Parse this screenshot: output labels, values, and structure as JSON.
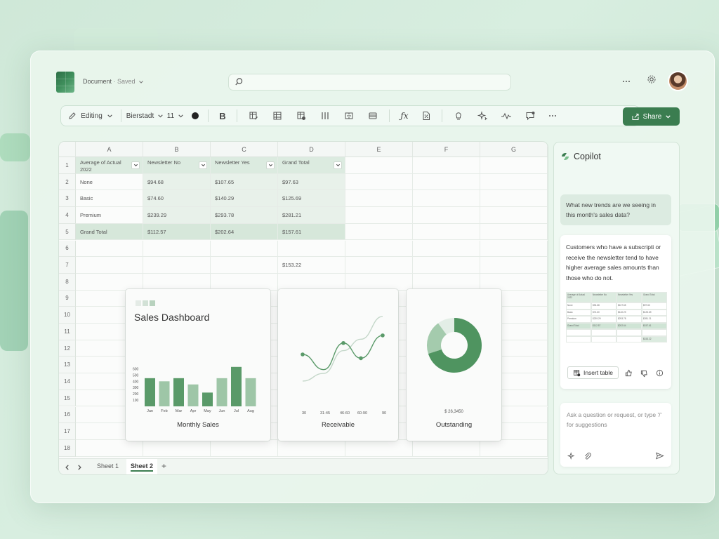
{
  "app": {
    "title": "Document",
    "status": "Saved",
    "search_placeholder": ""
  },
  "ribbon": {
    "mode": "Editing",
    "font": "Bierstadt",
    "font_size": "11",
    "bold": "B",
    "share": "Share"
  },
  "grid": {
    "columns": [
      "A",
      "B",
      "C",
      "D",
      "E",
      "F",
      "G"
    ],
    "rows": [
      "1",
      "2",
      "3",
      "4",
      "5",
      "6",
      "7",
      "8",
      "9",
      "10",
      "11",
      "12",
      "13",
      "14",
      "15",
      "16",
      "17",
      "18"
    ],
    "pivot_headers": [
      "Average of Actual 2022",
      "Newsletter No",
      "Newsletter Yes",
      "Grand Total"
    ],
    "pivot_rows": [
      [
        "None",
        "$94.68",
        "$107.65",
        "$97.63"
      ],
      [
        "Basic",
        "$74.60",
        "$140.29",
        "$125.69"
      ],
      [
        "Premium",
        "$239.29",
        "$293.78",
        "$281.21"
      ],
      [
        "Grand Total",
        "$112.57",
        "$202.64",
        "$157.61"
      ]
    ],
    "extra_value": "$153.22"
  },
  "tabs": {
    "sheets": [
      "Sheet 1",
      "Sheet 2"
    ],
    "active": "Sheet 2",
    "add": "+"
  },
  "dashboard": {
    "title": "Sales Dashboard",
    "bar_caption": "Monthly Sales",
    "line_caption": "Receivable",
    "donut_caption": "Outstanding",
    "donut_value": "$ 26,3450"
  },
  "chart_data": [
    {
      "type": "bar",
      "categories": [
        "Jan",
        "Feb",
        "Mar",
        "Apr",
        "May",
        "Jun",
        "Jul",
        "Aug"
      ],
      "values": [
        450,
        400,
        450,
        350,
        220,
        450,
        630,
        450
      ],
      "yticks": [
        "600",
        "500",
        "400",
        "300",
        "200",
        "100"
      ],
      "ylim": [
        0,
        650
      ],
      "colors": [
        "#5a9a69",
        "#9ec6a7",
        "#5a9a69",
        "#9ec6a7",
        "#5a9a69",
        "#9ec6a7",
        "#5a9a69",
        "#9ec6a7"
      ]
    },
    {
      "type": "line",
      "categories": [
        "30",
        "31-45",
        "46-60",
        "60-90",
        "90"
      ],
      "series": [
        {
          "values": [
            60,
            40,
            75,
            55,
            85
          ],
          "color": "#5a9a69"
        },
        {
          "values": [
            25,
            35,
            65,
            80,
            110
          ],
          "color": "#c4d7c9"
        }
      ],
      "ylim": [
        0,
        120
      ]
    },
    {
      "type": "pie",
      "values": [
        70,
        20,
        10
      ],
      "colors": [
        "#4f9460",
        "#a4cbad",
        "#e3eee6"
      ]
    }
  ],
  "copilot": {
    "title": "Copilot",
    "question": "What new trends are we seeing in this month's sales data?",
    "response": "Customers who have a subscripti or receive the newsletter tend to have higher average sales amounts than those who do not.",
    "insert_table": "Insert table",
    "ask_placeholder": "Ask a question or request, or type '/' for suggestions"
  },
  "colors": {
    "accent": "#3b7d50",
    "bar_dark": "#5a9a69",
    "bar_light": "#9ec6a7"
  }
}
